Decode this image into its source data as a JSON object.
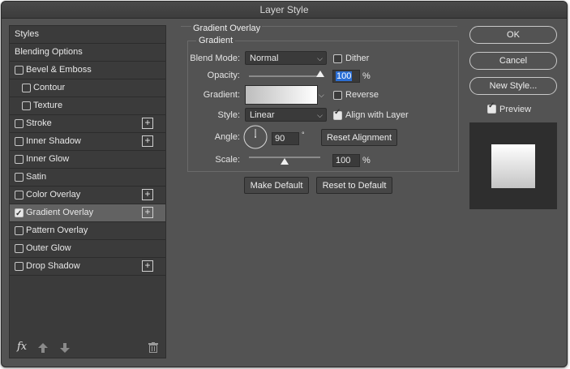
{
  "window": {
    "title": "Layer Style"
  },
  "styles_list": {
    "items": [
      {
        "label": "Styles",
        "checkbox": false,
        "checked": false,
        "plus": false,
        "indent": 0,
        "selected": false
      },
      {
        "label": "Blending Options",
        "checkbox": false,
        "checked": false,
        "plus": false,
        "indent": 0,
        "selected": false
      },
      {
        "label": "Bevel & Emboss",
        "checkbox": true,
        "checked": false,
        "plus": false,
        "indent": 0,
        "selected": false
      },
      {
        "label": "Contour",
        "checkbox": true,
        "checked": false,
        "plus": false,
        "indent": 1,
        "selected": false
      },
      {
        "label": "Texture",
        "checkbox": true,
        "checked": false,
        "plus": false,
        "indent": 1,
        "selected": false
      },
      {
        "label": "Stroke",
        "checkbox": true,
        "checked": false,
        "plus": true,
        "indent": 0,
        "selected": false
      },
      {
        "label": "Inner Shadow",
        "checkbox": true,
        "checked": false,
        "plus": true,
        "indent": 0,
        "selected": false
      },
      {
        "label": "Inner Glow",
        "checkbox": true,
        "checked": false,
        "plus": false,
        "indent": 0,
        "selected": false
      },
      {
        "label": "Satin",
        "checkbox": true,
        "checked": false,
        "plus": false,
        "indent": 0,
        "selected": false
      },
      {
        "label": "Color Overlay",
        "checkbox": true,
        "checked": false,
        "plus": true,
        "indent": 0,
        "selected": false
      },
      {
        "label": "Gradient Overlay",
        "checkbox": true,
        "checked": true,
        "plus": true,
        "indent": 0,
        "selected": true
      },
      {
        "label": "Pattern Overlay",
        "checkbox": true,
        "checked": false,
        "plus": false,
        "indent": 0,
        "selected": false
      },
      {
        "label": "Outer Glow",
        "checkbox": true,
        "checked": false,
        "plus": false,
        "indent": 0,
        "selected": false
      },
      {
        "label": "Drop Shadow",
        "checkbox": true,
        "checked": false,
        "plus": true,
        "indent": 0,
        "selected": false
      }
    ],
    "fx_label": "fx"
  },
  "panel": {
    "title": "Gradient Overlay",
    "subtitle": "Gradient",
    "blend_mode": {
      "label": "Blend Mode:",
      "value": "Normal"
    },
    "dither": {
      "label": "Dither",
      "checked": false
    },
    "opacity": {
      "label": "Opacity:",
      "value": "100",
      "unit": "%",
      "level": 1.0
    },
    "gradient": {
      "label": "Gradient:"
    },
    "reverse": {
      "label": "Reverse",
      "checked": false
    },
    "style": {
      "label": "Style:",
      "value": "Linear"
    },
    "align": {
      "label": "Align with Layer",
      "checked": true
    },
    "angle": {
      "label": "Angle:",
      "value": "90",
      "unit": "°"
    },
    "reset_alignment": "Reset Alignment",
    "scale": {
      "label": "Scale:",
      "value": "100",
      "unit": "%",
      "level": 0.5
    },
    "make_default": "Make Default",
    "reset_default": "Reset to Default"
  },
  "actions": {
    "ok": "OK",
    "cancel": "Cancel",
    "new_style": "New Style...",
    "preview": {
      "label": "Preview",
      "checked": true
    }
  },
  "colors": {
    "window_bg": "#535353",
    "list_bg": "#3b3b3b",
    "selected_row": "#626262",
    "highlight": "#2b6fd6"
  }
}
